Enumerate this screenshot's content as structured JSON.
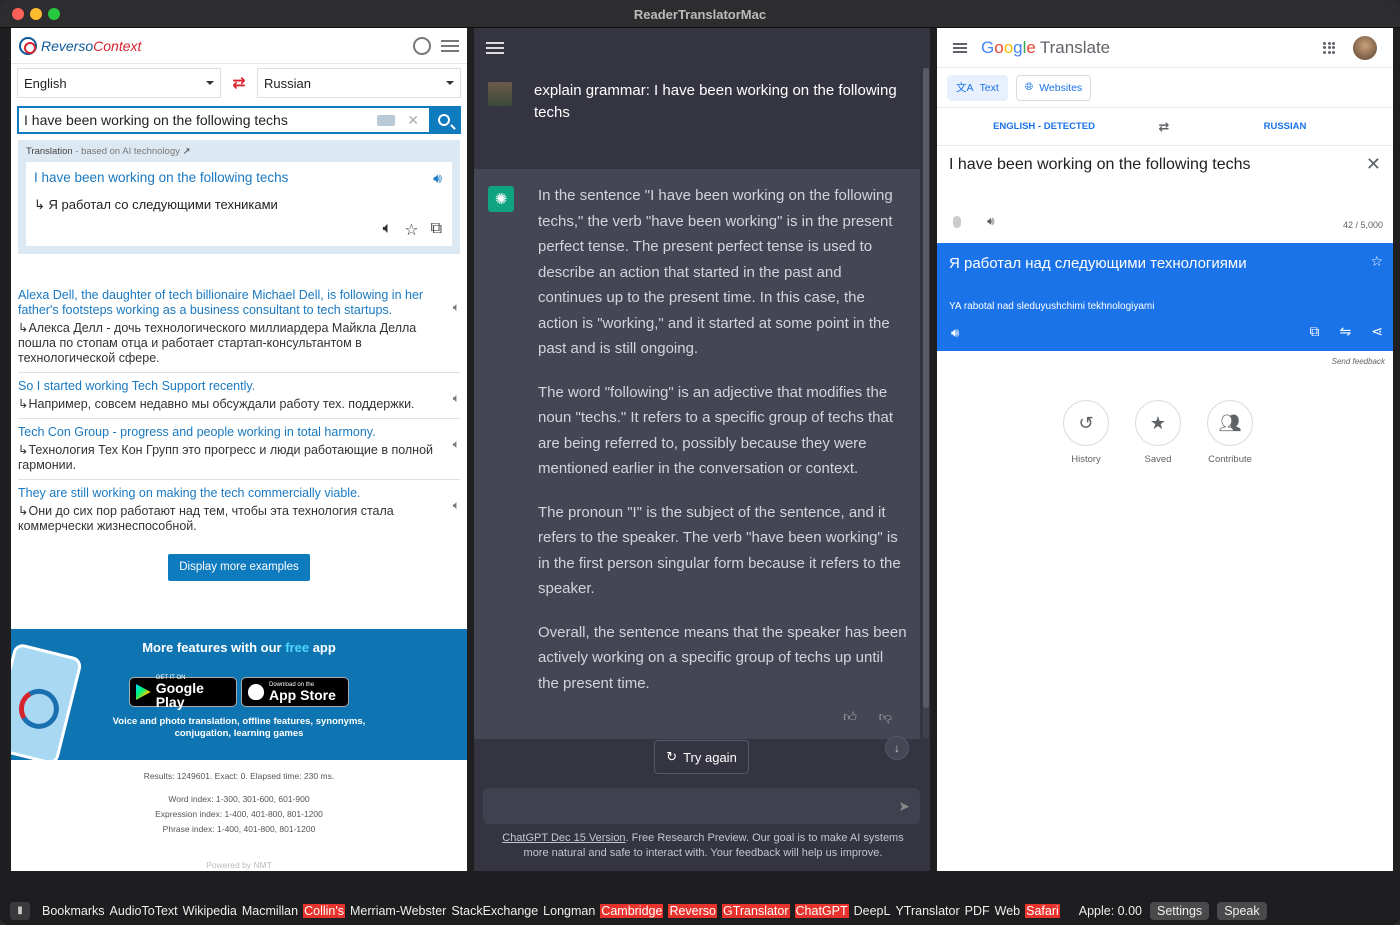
{
  "window": {
    "title": "ReaderTranslatorMac"
  },
  "reverso": {
    "logo_a": "Reverso",
    "logo_b": "Context",
    "lang_from": "English",
    "lang_to": "Russian",
    "query": "I have been working on the following techs",
    "trans_label": "Translation",
    "trans_label_sub": " - based on AI technology",
    "trans_src": "I have been working on the following techs",
    "trans_dst": "↳ Я работал со следующими техниками",
    "examples": [
      {
        "en": "Alexa Dell, the daughter of tech billionaire Michael Dell, is following in her father's footsteps working as a business consultant to tech startups.",
        "ru": "↳Алекса Делл - дочь технологического миллиардера Майкла Делла пошла по стопам отца и работает стартап-консультантом в технологической сфере."
      },
      {
        "en": "So I started working Tech Support recently.",
        "ru": "↳Например, совсем недавно мы обсуждали работу тех. поддержки."
      },
      {
        "en": "Tech Con Group - progress and people working in total harmony.",
        "ru": "↳Технология Тех Кон Групп это прогресс и люди работающие в полной гармонии."
      },
      {
        "en": "They are still working on making the tech commercially viable.",
        "ru": "↳Они до сих пор работают над тем, чтобы эта технология стала коммерчески жизнеспособной."
      }
    ],
    "more_button": "Display more examples",
    "promo_pre": "More features with our ",
    "promo_free": "free",
    "promo_post": " app",
    "gp_small": "GET IT ON",
    "gp_big": "Google Play",
    "as_small": "Download on the",
    "as_big": "App Store",
    "promo_desc": "Voice and photo translation, offline features, synonyms, conjugation, learning games",
    "stats1": "Results: 1249601. Exact: 0. Elapsed time: 230 ms.",
    "stats2": "Word index: 1-300, 301-600, 601-900",
    "stats3": "Expression index: 1-400, 401-800, 801-1200",
    "stats4": "Phrase index: 1-400, 401-800, 801-1200",
    "powered": "Powered by NMT"
  },
  "chatgpt": {
    "user_msg": "explain grammar: I have been working on the following techs",
    "para1": "In the sentence \"I have been working on the following techs,\" the verb \"have been working\" is in the present perfect tense. The present perfect tense is used to describe an action that started in the past and continues up to the present time. In this case, the action is \"working,\" and it started at some point in the past and is still ongoing.",
    "para2": "The word \"following\" is an adjective that modifies the noun \"techs.\" It refers to a specific group of techs that are being referred to, possibly because they were mentioned earlier in the conversation or context.",
    "para3": "The pronoun \"I\" is the subject of the sentence, and it refers to the speaker. The verb \"have been working\" is in the first person singular form because it refers to the speaker.",
    "para4": "Overall, the sentence means that the speaker has been actively working on a specific group of techs up until the present time.",
    "try_again": "Try again",
    "footer_link": "ChatGPT Dec 15 Version",
    "footer_text": ". Free Research Preview. Our goal is to make AI systems more natural and safe to interact with. Your feedback will help us improve."
  },
  "google": {
    "logo": "Google",
    "product": "Translate",
    "tab_text": "Text",
    "tab_websites": "Websites",
    "lang_from": "ENGLISH - DETECTED",
    "lang_to": "RUSSIAN",
    "source": "I have been working on the following techs",
    "count": "42 / 5,000",
    "result": "Я работал над следующими технологиями",
    "romanized": "YA rabotal nad sleduyushchimi tekhnologiyami",
    "send_feedback": "Send feedback",
    "history": "History",
    "saved": "Saved",
    "contribute": "Contribute"
  },
  "bottombar": {
    "items": [
      {
        "label": "Bookmarks",
        "red": false
      },
      {
        "label": "AudioToText",
        "red": false
      },
      {
        "label": "Wikipedia",
        "red": false
      },
      {
        "label": "Macmillan",
        "red": false
      },
      {
        "label": "Collin's",
        "red": true
      },
      {
        "label": "Merriam-Webster",
        "red": false
      },
      {
        "label": "StackExchange",
        "red": false
      },
      {
        "label": "Longman",
        "red": false
      },
      {
        "label": "Cambridge",
        "red": true
      },
      {
        "label": "Reverso",
        "red": true
      },
      {
        "label": "GTranslator",
        "red": true
      },
      {
        "label": "ChatGPT",
        "red": true
      },
      {
        "label": "DeepL",
        "red": false
      },
      {
        "label": "YTranslator",
        "red": false
      },
      {
        "label": "PDF",
        "red": false
      },
      {
        "label": "Web",
        "red": false
      },
      {
        "label": "Safari",
        "red": true
      }
    ],
    "apple": "Apple: 0.00",
    "settings": "Settings",
    "speak": "Speak"
  }
}
